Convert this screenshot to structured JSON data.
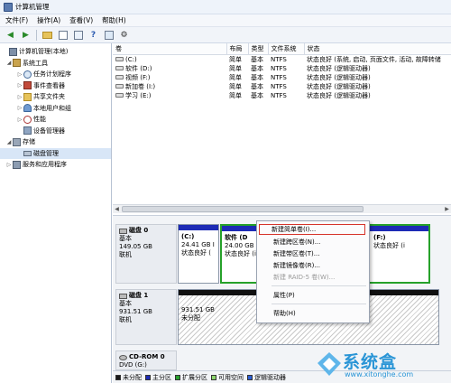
{
  "window": {
    "title": "计算机管理"
  },
  "menu": [
    "文件(F)",
    "操作(A)",
    "查看(V)",
    "帮助(H)"
  ],
  "toolbar": {
    "icons": [
      "back-arrow-icon",
      "forward-arrow-icon",
      "folder-icon",
      "console-icon",
      "properties-icon",
      "help-icon",
      "export-icon",
      "settings-icon"
    ]
  },
  "tree": [
    {
      "label": "计算机管理(本地)",
      "indent": 0,
      "exp": "",
      "icon": "computer-icon"
    },
    {
      "label": "系统工具",
      "indent": 1,
      "exp": "◢",
      "icon": "tools-icon"
    },
    {
      "label": "任务计划程序",
      "indent": 2,
      "exp": "▷",
      "icon": "clock-icon"
    },
    {
      "label": "事件查看器",
      "indent": 2,
      "exp": "▷",
      "icon": "event-icon"
    },
    {
      "label": "共享文件夹",
      "indent": 2,
      "exp": "▷",
      "icon": "folder-icon"
    },
    {
      "label": "本地用户和组",
      "indent": 2,
      "exp": "▷",
      "icon": "users-icon"
    },
    {
      "label": "性能",
      "indent": 2,
      "exp": "▷",
      "icon": "performance-icon"
    },
    {
      "label": "设备管理器",
      "indent": 2,
      "exp": "",
      "icon": "device-icon"
    },
    {
      "label": "存储",
      "indent": 1,
      "exp": "◢",
      "icon": "storage-icon"
    },
    {
      "label": "磁盘管理",
      "indent": 2,
      "exp": "",
      "icon": "disk-icon",
      "selected": true
    },
    {
      "label": "服务和应用程序",
      "indent": 1,
      "exp": "▷",
      "icon": "services-icon"
    }
  ],
  "volumes": {
    "headers": [
      "卷",
      "布局",
      "类型",
      "文件系统",
      "状态"
    ],
    "rows": [
      [
        "(C:)",
        "简单",
        "基本",
        "NTFS",
        "状态良好 (系统, 启动, 页面文件, 活动, 故障转储"
      ],
      [
        "软件 (D:)",
        "简单",
        "基本",
        "NTFS",
        "状态良好 (逻辑驱动器)"
      ],
      [
        "视频 (F:)",
        "简单",
        "基本",
        "NTFS",
        "状态良好 (逻辑驱动器)"
      ],
      [
        "新加卷 (I:)",
        "简单",
        "基本",
        "NTFS",
        "状态良好 (逻辑驱动器)"
      ],
      [
        "学习 (E:)",
        "简单",
        "基本",
        "NTFS",
        "状态良好 (逻辑驱动器)"
      ]
    ]
  },
  "disks": {
    "disk0": {
      "name": "磁盘 0",
      "type": "基本",
      "size": "149.05 GB",
      "status": "联机",
      "partitions": [
        {
          "l1": "(C:)",
          "l2": "24.41 GB I",
          "l3": "状态良好 ("
        },
        {
          "l1": "软件  (D",
          "l2": "24.00 GB",
          "l3": "状态良好 (i"
        },
        {
          "l1": "(F:)",
          "l2": "",
          "l3": "状态良好 (i"
        }
      ]
    },
    "disk1": {
      "name": "磁盘 1",
      "type": "基本",
      "size": "931.51 GB",
      "status": "联机",
      "partitions": [
        {
          "l1": "",
          "l2": "931.51 GB",
          "l3": "未分配"
        }
      ]
    },
    "cdrom": {
      "name": "CD-ROM 0",
      "line2": "DVD (G:)"
    }
  },
  "context_menu": {
    "items": [
      {
        "label": "新建简单卷(I)...",
        "highlight": true
      },
      {
        "label": "新建跨区卷(N)..."
      },
      {
        "label": "新建带区卷(T)..."
      },
      {
        "label": "新建镜像卷(R)..."
      },
      {
        "label": "新建 RAID-5 卷(W)...",
        "disabled": true
      },
      {
        "label": "属性(P)",
        "sep_before": true
      },
      {
        "label": "帮助(H)",
        "sep_before": true
      }
    ]
  },
  "legend": [
    {
      "label": "未分配",
      "color": "#1a1a1a"
    },
    {
      "label": "主分区",
      "color": "#1d2bb5"
    },
    {
      "label": "扩展分区",
      "color": "#2aa12e"
    },
    {
      "label": "可用空间",
      "color": "#8bd46c"
    },
    {
      "label": "逻辑驱动器",
      "color": "#2c5fd6"
    }
  ],
  "watermark": {
    "brand": "系统盒",
    "url": "www.xitonghe.com"
  }
}
